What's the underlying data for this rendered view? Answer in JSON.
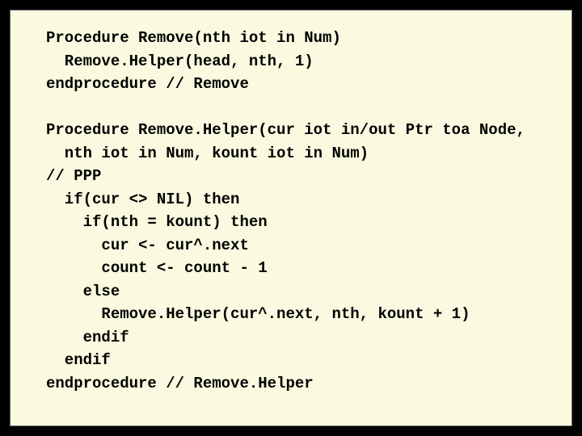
{
  "code": {
    "l1": "Procedure Remove(nth iot in Num)",
    "l2": "  Remove.Helper(head, nth, 1)",
    "l3": "endprocedure // Remove",
    "l4": "",
    "l5": "Procedure Remove.Helper(cur iot in/out Ptr toa Node,",
    "l6": "  nth iot in Num, kount iot in Num)",
    "l7": "// PPP",
    "l8": "  if(cur <> NIL) then",
    "l9": "    if(nth = kount) then",
    "l10": "      cur <- cur^.next",
    "l11": "      count <- count - 1",
    "l12": "    else",
    "l13": "      Remove.Helper(cur^.next, nth, kount + 1)",
    "l14": "    endif",
    "l15": "  endif",
    "l16": "endprocedure // Remove.Helper"
  }
}
